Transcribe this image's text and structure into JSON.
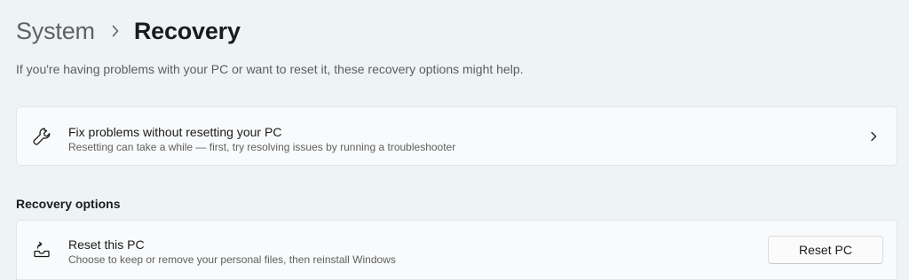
{
  "breadcrumb": {
    "parent": "System",
    "separator_icon": "chevron-right-icon",
    "current": "Recovery"
  },
  "description": "If you're having problems with your PC or want to reset it, these recovery options might help.",
  "fix_card": {
    "icon": "wrench-icon",
    "title": "Fix problems without resetting your PC",
    "subtitle": "Resetting can take a while — first, try resolving issues by running a troubleshooter",
    "trailing_icon": "chevron-right-icon"
  },
  "recovery_options": {
    "heading": "Recovery options",
    "reset_card": {
      "icon": "reset-pc-icon",
      "title": "Reset this PC",
      "subtitle": "Choose to keep or remove your personal files, then reinstall Windows",
      "button_label": "Reset PC"
    }
  },
  "colors": {
    "background": "#eef3f5",
    "card_background": "#f8fafb",
    "card_border": "#e2e6e8",
    "primary_text": "#1b1b1b",
    "secondary_text": "#5f6163"
  }
}
